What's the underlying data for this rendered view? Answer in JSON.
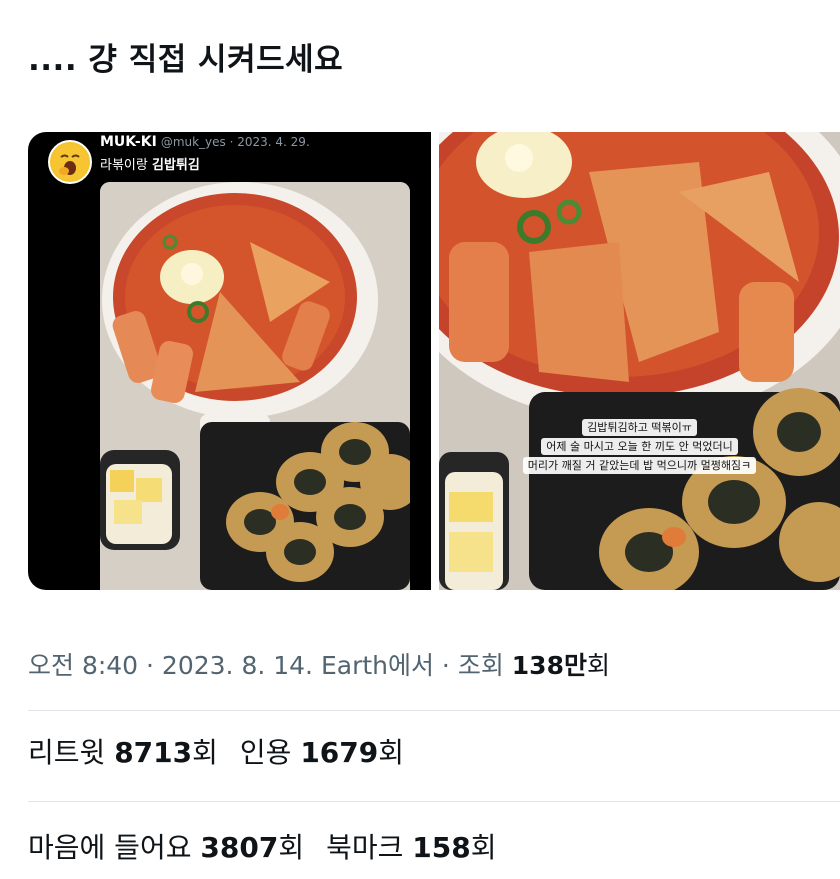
{
  "tweet": {
    "text": ".... 걍 직접 시켜드세요"
  },
  "embedded_tweet": {
    "name": "MUK-KI",
    "handle_date": "@muk_yes · 2023. 4. 29.",
    "body_prefix": "라볶이랑 ",
    "body_bold": "김밥튀김",
    "avatar_icon": "yawning-face-emoji"
  },
  "photo_caption": {
    "line1": "김밥튀김하고 떡볶이ㅠ",
    "line2": "어제 술 마시고 오늘 한 끼도 안 먹었더니",
    "line3": "머리가 깨질 거 같았는데 밥 먹으니까 멀쩡해짐ㅋ"
  },
  "meta": {
    "time_date_source": "오전 8:40 · 2023. 8. 14. Earth에서 · 조회 ",
    "views_num": "138만",
    "views_unit": "회"
  },
  "stats": {
    "retweet_label": "리트윗 ",
    "retweet_count": "8713",
    "retweet_unit": "회",
    "quote_label": "인용 ",
    "quote_count": "1679",
    "quote_unit": "회",
    "like_label": "마음에 들어요 ",
    "like_count": "3807",
    "like_unit": "회",
    "bookmark_label": "북마크 ",
    "bookmark_count": "158",
    "bookmark_unit": "회"
  },
  "colors": {
    "text_primary": "#0f1419",
    "text_secondary": "#536471",
    "divider": "#e1e4e8"
  }
}
